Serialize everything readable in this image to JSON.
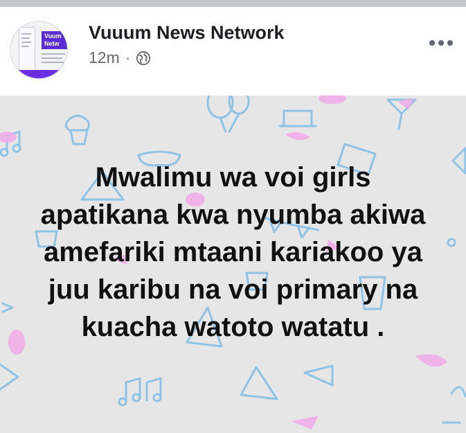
{
  "post": {
    "page_name": "Vuuum News Network",
    "time": "12m",
    "separator": "·",
    "privacy_icon": "globe-icon",
    "more_icon": "more-options-icon",
    "avatar": {
      "banner_text_line1": "Vuum",
      "banner_text_line2": "Netw",
      "accent": "#5b2bd3"
    },
    "text_lines": [
      "Mwalimu wa voi girls",
      "apatikana kwa nyumba akiwa",
      "amefariki mtaani kariakoo ya",
      "juu karibu na voi primary na",
      "kuacha watoto watatu ."
    ],
    "background_color": "#e6e6e6"
  }
}
